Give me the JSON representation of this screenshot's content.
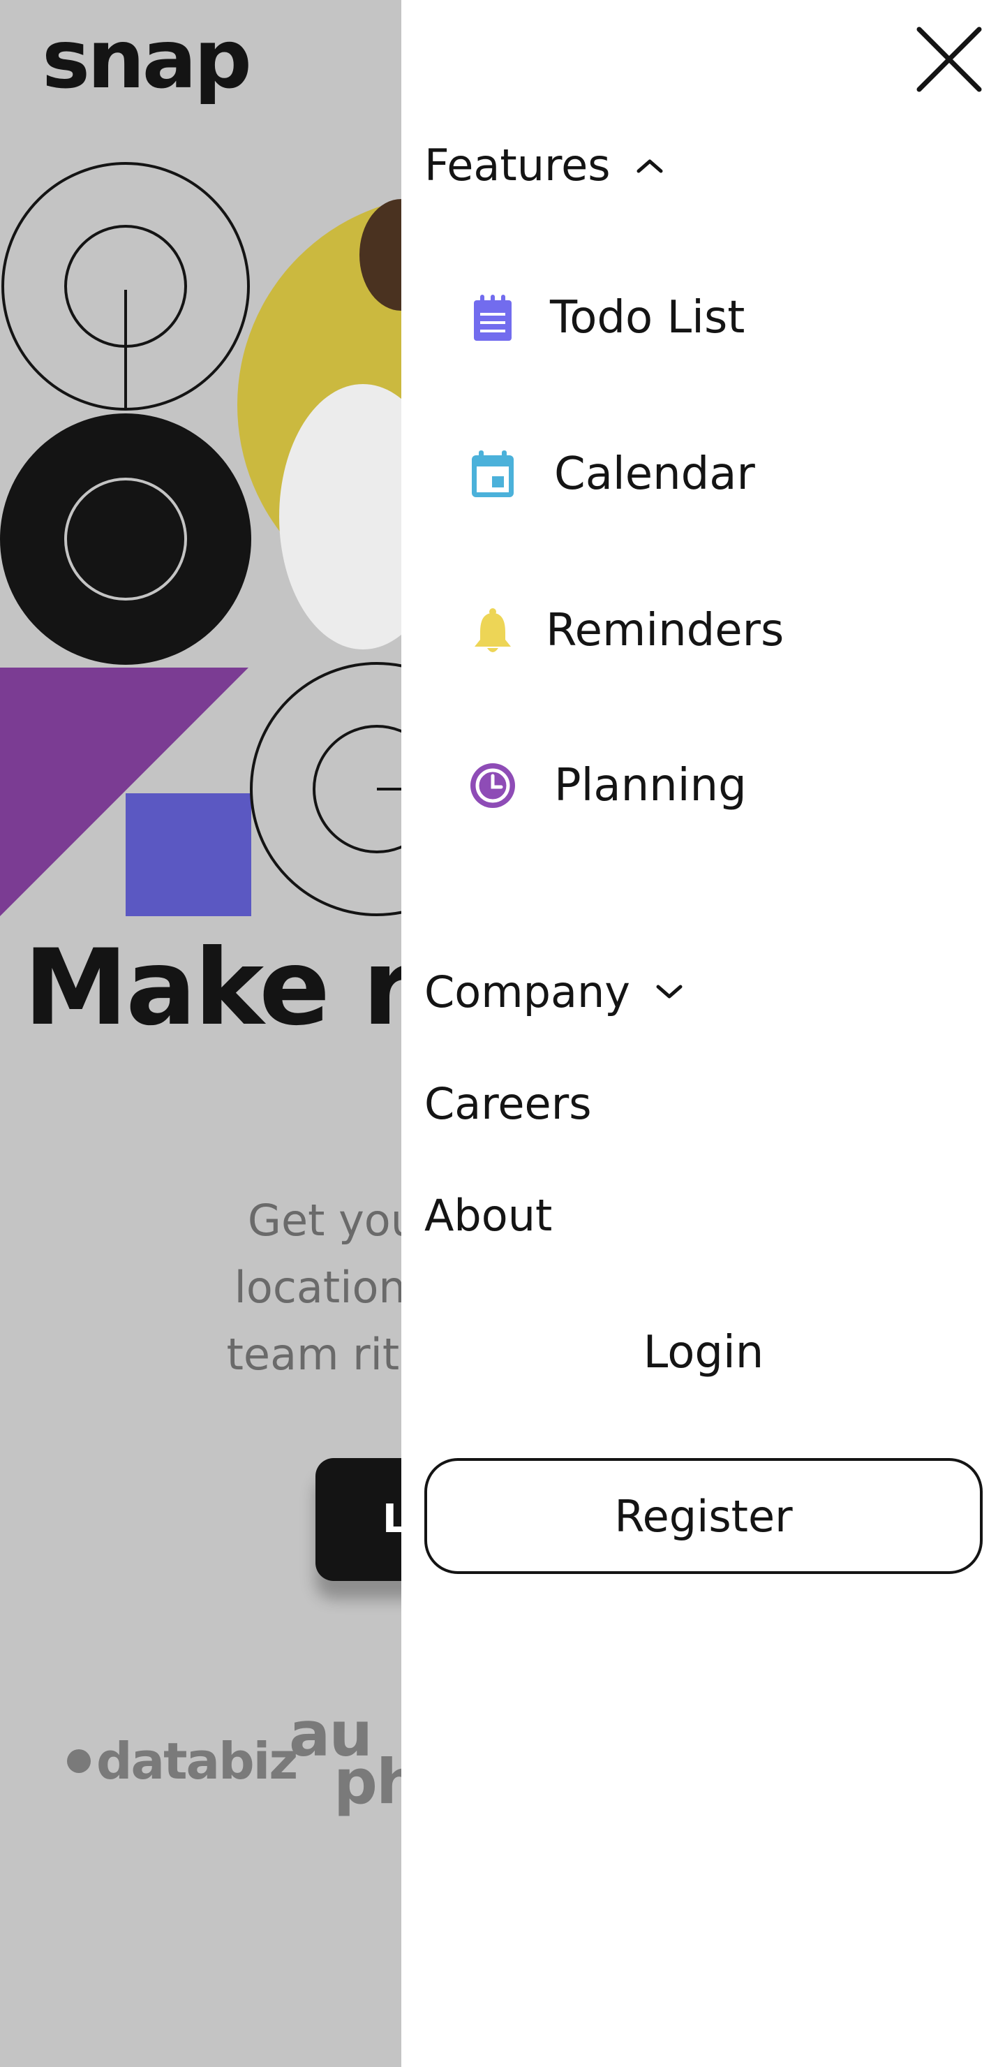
{
  "brand": {
    "logo": "snap"
  },
  "hero": {
    "title": "Make re",
    "lines": [
      "Get your team",
      "location. Strean",
      "team rituals and"
    ],
    "cta_label": "L"
  },
  "clients": {
    "databiz": "databiz",
    "audiophile_line1": "au",
    "audiophile_line2": "ph"
  },
  "menu": {
    "features": {
      "label": "Features",
      "expanded": true,
      "items": [
        {
          "label": "Todo List",
          "icon": "todo-list-icon",
          "color": "#726cee"
        },
        {
          "label": "Calendar",
          "icon": "calendar-icon",
          "color": "#4bb1da"
        },
        {
          "label": "Reminders",
          "icon": "bell-icon",
          "color": "#edd556"
        },
        {
          "label": "Planning",
          "icon": "clock-icon",
          "color": "#8e4cb6"
        }
      ]
    },
    "company": {
      "label": "Company",
      "expanded": false
    },
    "links": [
      "Careers",
      "About"
    ],
    "login_label": "Login",
    "register_label": "Register"
  },
  "colors": {
    "overlay_bg": "#c4c4c4",
    "ink": "#141414",
    "purple": "#7b3c93",
    "indigo": "#5b58c2",
    "yellow": "#cbb93f"
  }
}
